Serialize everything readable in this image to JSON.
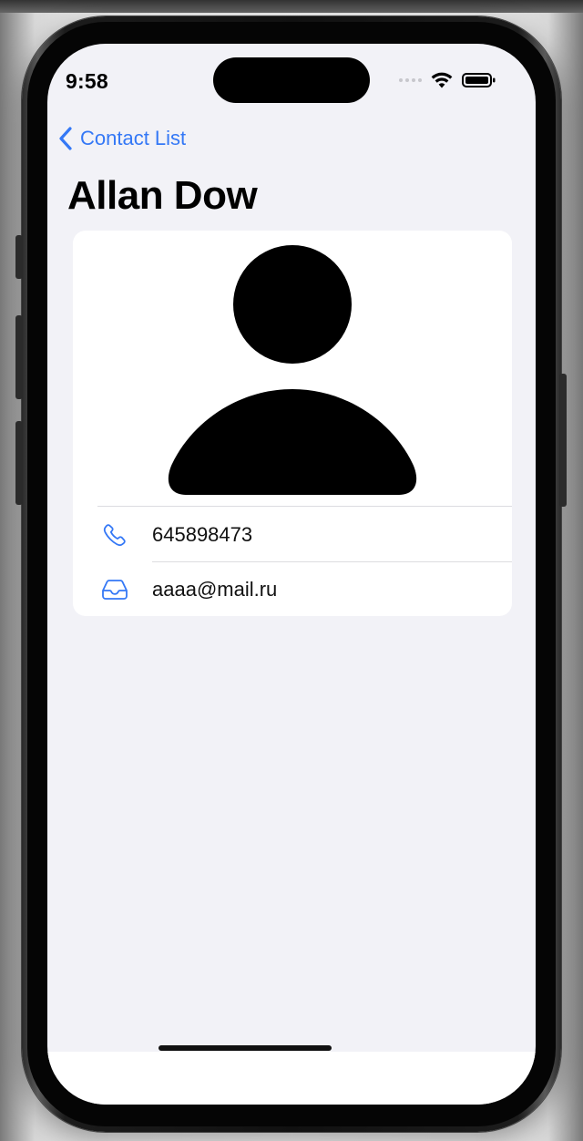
{
  "status_bar": {
    "time": "9:58",
    "icons": [
      "signal-dots-icon",
      "wifi-icon",
      "battery-icon"
    ]
  },
  "nav": {
    "back_label": "Contact List",
    "title": "Allan Dow"
  },
  "contact": {
    "avatar_icon": "person-silhouette-icon",
    "phone": "645898473",
    "email": "aaaa@mail.ru"
  },
  "colors": {
    "accent": "#3478f6",
    "background": "#f2f2f7",
    "card": "#ffffff",
    "text": "#000000"
  }
}
